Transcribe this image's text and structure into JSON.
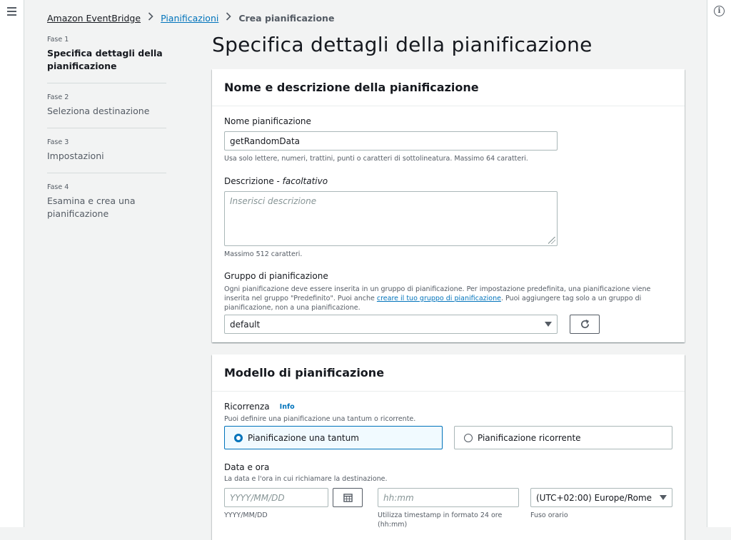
{
  "breadcrumb": {
    "root": "Amazon EventBridge",
    "section": "Pianificazioni",
    "current": "Crea pianificazione"
  },
  "steps": [
    {
      "num": "Fase 1",
      "label": "Specifica dettagli della pianificazione"
    },
    {
      "num": "Fase 2",
      "label": "Seleziona destinazione"
    },
    {
      "num": "Fase 3",
      "label": "Impostazioni"
    },
    {
      "num": "Fase 4",
      "label": "Esamina e crea una pianificazione"
    }
  ],
  "page_title": "Specifica dettagli della pianificazione",
  "name_panel": {
    "title": "Nome e descrizione della pianificazione",
    "name_label": "Nome pianificazione",
    "name_value": "getRandomData",
    "name_help": "Usa solo lettere, numeri, trattini, punti o caratteri di sottolineatura. Massimo 64 caratteri.",
    "desc_label": "Descrizione - ",
    "desc_optional": "facoltativo",
    "desc_placeholder": "Inserisci descrizione",
    "desc_help": "Massimo 512 caratteri.",
    "group_label": "Gruppo di pianificazione",
    "group_help_1": "Ogni pianificazione deve essere inserita in un gruppo di pianificazione. Per impostazione predefinita, una pianificazione viene inserita nel gruppo \"Predefinito\". Puoi anche ",
    "group_help_link": "creare il tuo gruppo di pianificazione",
    "group_help_2": ". Puoi aggiungere tag solo a un gruppo di pianificazione, non a una pianificazione.",
    "group_value": "default"
  },
  "pattern_panel": {
    "title": "Modello di pianificazione",
    "recurrence_label": "Ricorrenza",
    "info_link": "Info",
    "recurrence_help": "Puoi definire una pianificazione una tantum o ricorrente.",
    "option_one_time": "Pianificazione una tantum",
    "option_recurring": "Pianificazione ricorrente",
    "selected_option": "one_time",
    "datetime_label": "Data e ora",
    "datetime_help": "La data e l'ora in cui richiamare la destinazione.",
    "date_placeholder": "YYYY/MM/DD",
    "date_help": "YYYY/MM/DD",
    "time_placeholder": "hh:mm",
    "time_help": "Utilizza timestamp in formato 24 ore (hh:mm)",
    "timezone_value": "(UTC+02:00) Europe/Rome",
    "timezone_help": "Fuso orario"
  },
  "icons": {
    "menu": "hamburger-menu-icon",
    "info": "info-circle-icon",
    "breadcrumb_sep": "chevron-right-icon",
    "refresh": "refresh-icon",
    "calendar": "calendar-icon",
    "dropdown": "caret-down-icon"
  },
  "colors": {
    "link": "#0073bb",
    "page_bg": "#f2f3f3",
    "selected_tile_bg": "#f1faff"
  }
}
